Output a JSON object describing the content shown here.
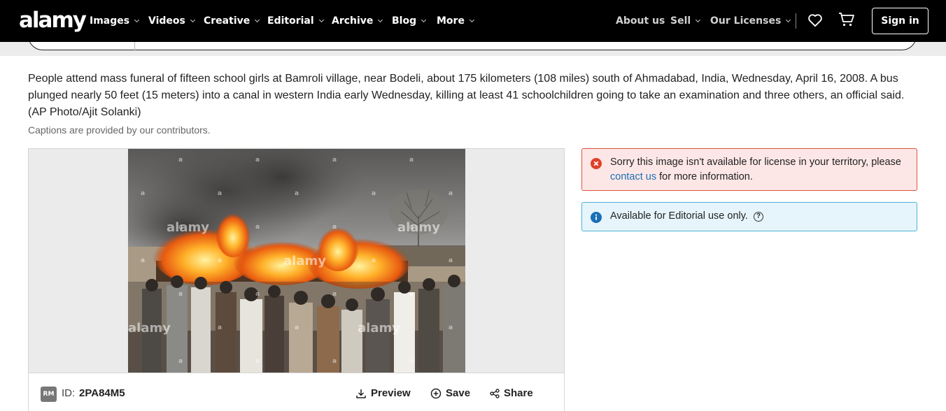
{
  "brand": {
    "logo_text": "alamy"
  },
  "nav": {
    "items": [
      {
        "label": "Images"
      },
      {
        "label": "Videos"
      },
      {
        "label": "Creative"
      },
      {
        "label": "Editorial"
      },
      {
        "label": "Archive"
      },
      {
        "label": "Blog"
      },
      {
        "label": "More"
      }
    ],
    "right": {
      "about": "About us",
      "sell": "Sell",
      "licenses": "Our Licenses",
      "signin": "Sign in"
    }
  },
  "caption": {
    "text": "People attend mass funeral of fifteen school girls at Bamroli village, near Bodeli, about 175 kilometers (108 miles) south of Ahmadabad, India, Wednesday, April 16, 2008. A bus plunged nearly 50 feet (15 meters) into a canal in western India early Wednesday, killing at least 41 schoolchildren going to take an examination and three others, an official said. (AP Photo/Ajit Solanki)",
    "note": "Captions are provided by our contributors."
  },
  "image": {
    "watermark": "alamy",
    "watermark_letter": "a"
  },
  "toolbar": {
    "badge": "RM",
    "id_label": "ID:",
    "id_value": "2PA84M5",
    "preview": "Preview",
    "save": "Save",
    "share": "Share"
  },
  "alerts": {
    "error_prefix": "Sorry this image isn't available for license in your territory, please ",
    "error_link": "contact us",
    "error_suffix": " for more information.",
    "info": "Available for Editorial use only.",
    "info_help": "?"
  },
  "colors": {
    "nav_bg": "#000000",
    "error_border": "#e0533d",
    "error_bg": "#fde7e6",
    "info_border": "#4fb1d6",
    "info_bg": "#e6f5fb",
    "link": "#1a6fb5"
  }
}
